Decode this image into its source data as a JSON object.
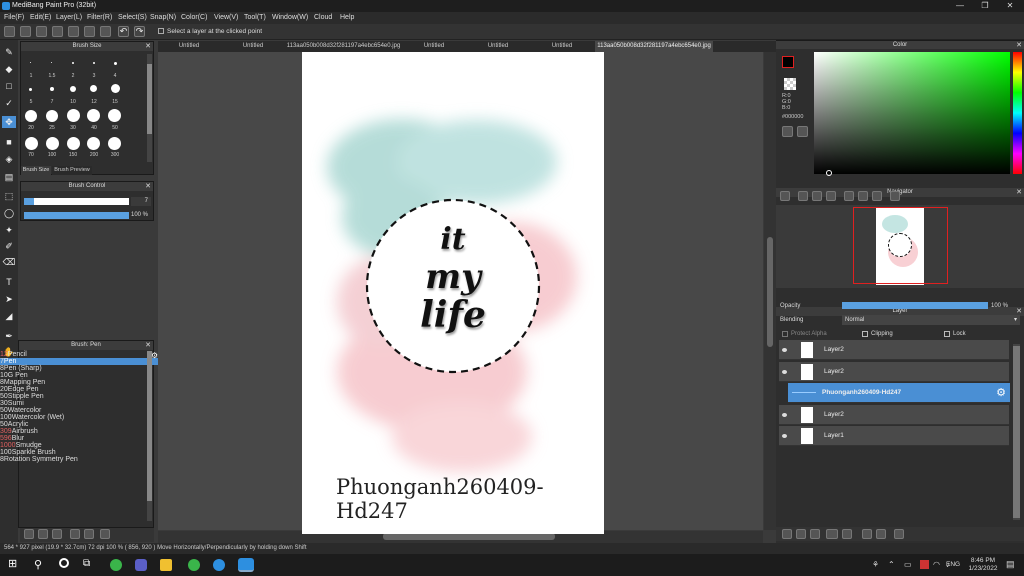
{
  "app": {
    "title": "MediBang Paint Pro (32bit)"
  },
  "menu": [
    "File(F)",
    "Edit(E)",
    "Layer(L)",
    "Filter(R)",
    "Select(S)",
    "Snap(N)",
    "Color(C)",
    "View(V)",
    "Tool(T)",
    "Window(W)",
    "Cloud",
    "Help"
  ],
  "toolbar": {
    "select_layer_label": "Select a layer at the clicked point"
  },
  "tabs": [
    "Untitled",
    "Untitled",
    "113aa050b008d32f281197a4ebc654e0.jpg",
    "Untitled",
    "Untitled",
    "Untitled",
    "113aa050b008d32f281197a4ebc654e0.jpg"
  ],
  "brush_size": {
    "title": "Brush Size",
    "labels": [
      "1",
      "1.5",
      "2",
      "3",
      "4",
      "5",
      "7",
      "10",
      "12",
      "15",
      "20",
      "25",
      "30",
      "40",
      "50",
      "70",
      "100",
      "150",
      "200",
      "300"
    ],
    "tab1": "Brush Size",
    "tab2": "Brush Preview"
  },
  "brush_control": {
    "title": "Brush Control",
    "size_value": "7",
    "opacity_value": "100 %"
  },
  "brush_list": {
    "title": "Brush: Pen",
    "items": [
      {
        "size": "12",
        "name": "Pencil",
        "color": "#333333"
      },
      {
        "size": "7",
        "name": "Pen",
        "color": "#1e5aa8"
      },
      {
        "size": "8",
        "name": "Pen (Sharp)",
        "color": "#222222"
      },
      {
        "size": "10",
        "name": "G Pen",
        "color": "#e02020"
      },
      {
        "size": "8",
        "name": "Mapping Pen",
        "color": "#e02020"
      },
      {
        "size": "20",
        "name": "Edge Pen",
        "color": "#20a020"
      },
      {
        "size": "50",
        "name": "Stipple Pen",
        "color": "#e0d020"
      },
      {
        "size": "30",
        "name": "Sumi",
        "color": "#e0d020"
      },
      {
        "size": "50",
        "name": "Watercolor",
        "color": "#40c0e0"
      },
      {
        "size": "100",
        "name": "Watercolor (Wet)",
        "color": "#40c0e0"
      },
      {
        "size": "50",
        "name": "Acrylic",
        "color": "#e0d020"
      },
      {
        "size": "309",
        "name": "Airbrush",
        "color": "#f4c0c0"
      },
      {
        "size": "596",
        "name": "Blur",
        "color": "#f060c0"
      },
      {
        "size": "1000",
        "name": "Smudge",
        "color": "#f4d0b0"
      },
      {
        "size": "100",
        "name": "Sparkle Brush",
        "color": "#2050c0"
      },
      {
        "size": "8",
        "name": "Rotation Symmetry Pen",
        "color": "#e02020"
      }
    ]
  },
  "canvas": {
    "text1": "it",
    "text2": "my",
    "text3": "life",
    "signature": "Phuonganh260409-Hd247"
  },
  "color_panel": {
    "title": "Color",
    "r": "R:0",
    "g": "G:0",
    "b": "B:0",
    "hex": "#000000"
  },
  "navigator": {
    "title": "Navigator"
  },
  "layer_panel": {
    "title": "Layer",
    "opacity_label": "Opacity",
    "opacity_value": "100 %",
    "blending_label": "Blending",
    "blending_value": "Normal",
    "protect_alpha": "Protect Alpha",
    "clipping": "Clipping",
    "lock": "Lock",
    "layers": [
      {
        "name": "Layer2"
      },
      {
        "name": "Layer2"
      },
      {
        "name": "Phuonganh260409-Hd247",
        "selected": true
      },
      {
        "name": "Layer2"
      },
      {
        "name": "Layer1"
      }
    ]
  },
  "status": {
    "text": "564 * 927 pixel  (19.9 * 32.7cm)  72 dpi  100 %  ( 856, 920 )  Move Horizontally/Perpendicularly by holding down Shift"
  },
  "taskbar": {
    "time": "8:46 PM",
    "date": "1/23/2022",
    "lang": "ENG"
  },
  "colors": {
    "accent": "#4a90d0",
    "selected_layer": "#4a8fd4"
  }
}
